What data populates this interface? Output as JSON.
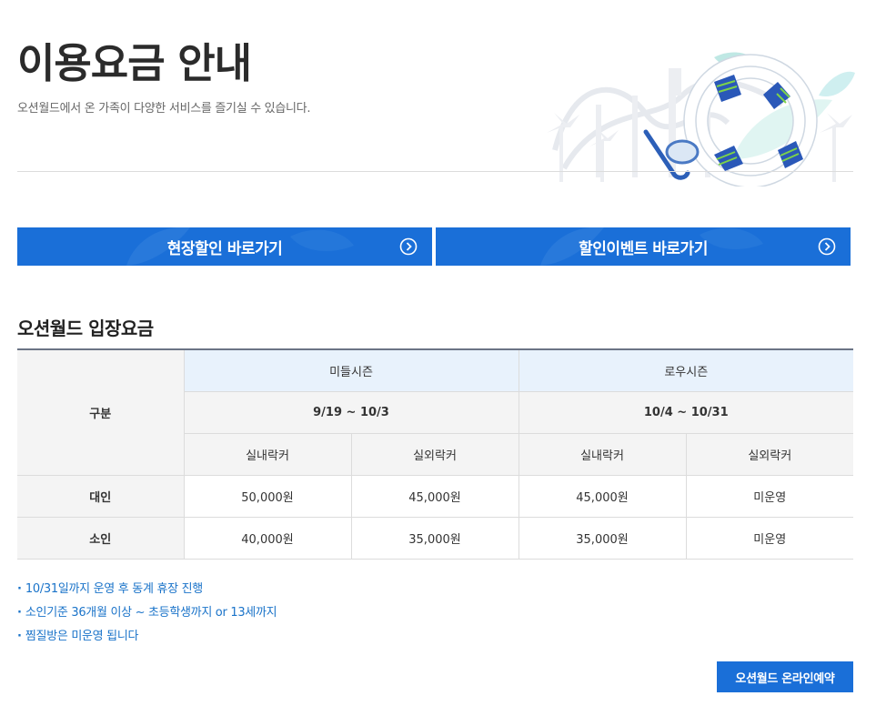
{
  "header": {
    "title": "이용요금 안내",
    "subtitle": "오션월드에서 온 가족이 다양한 서비스를 즐기실 수 있습니다."
  },
  "cta": {
    "onsite_discount": "현장할인 바로가기",
    "discount_event": "할인이벤트 바로가기"
  },
  "section": {
    "title": "오션월드 입장요금"
  },
  "table": {
    "category_label": "구분",
    "seasons": [
      {
        "name": "미들시즌",
        "dates": "9/19 ~ 10/3"
      },
      {
        "name": "로우시즌",
        "dates": "10/4 ~ 10/31"
      }
    ],
    "lockers": [
      "실내락커",
      "실외락커",
      "실내락커",
      "실외락커"
    ],
    "rows": [
      {
        "label": "대인",
        "values": [
          "50,000원",
          "45,000원",
          "45,000원",
          "미운영"
        ]
      },
      {
        "label": "소인",
        "values": [
          "40,000원",
          "35,000원",
          "35,000원",
          "미운영"
        ]
      }
    ]
  },
  "notes": [
    "10/31일까지 운영 후 동계 휴장 진행",
    "소인기준 36개월 이상 ~ 초등학생까지 or 13세까지",
    "찜질방은 미운영 됩니다"
  ],
  "reserve_button": "오션월드 온라인예약",
  "colors": {
    "primary": "#1a6fd8",
    "note_text": "#1a73c9",
    "season_header_bg": "#e8f2fc"
  }
}
